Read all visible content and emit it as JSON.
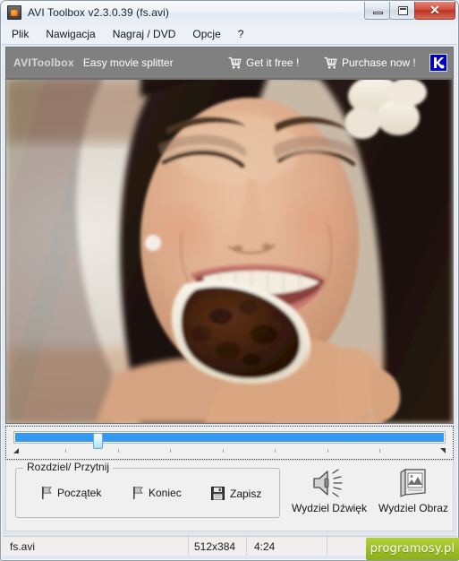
{
  "window": {
    "title": "AVI Toolbox v2.3.0.39 (fs.avi)",
    "icon": "app-film-icon",
    "controls": {
      "minimize": "minimize-button",
      "maximize": "maximize-button",
      "close_glyph": "✕"
    }
  },
  "menubar": {
    "items": [
      {
        "label": "Plik"
      },
      {
        "label": "Nawigacja"
      },
      {
        "label": "Nagraj / DVD"
      },
      {
        "label": "Opcje"
      },
      {
        "label": "?"
      }
    ]
  },
  "adbar": {
    "brand": "AVIToolbox",
    "tagline": "Easy movie splitter",
    "get_free_label": "Get it free !",
    "purchase_label": "Purchase now !",
    "badge_letter": "K",
    "background_color": "#808080",
    "badge_color": "#0000d2"
  },
  "player": {
    "scrub": {
      "position_percent": 17,
      "fill_color": "#3399f3",
      "tick_count": 9
    }
  },
  "tools": {
    "group_title": "Rozdziel/ Przytnij",
    "start_label": "Początek",
    "end_label": "Koniec",
    "save_label": "Zapisz",
    "extract_audio_label": "Wydziel Dźwięk",
    "extract_video_label": "Wydziel Obraz"
  },
  "statusbar": {
    "filename": "fs.avi",
    "dimensions": "512x384",
    "duration": "4:24",
    "watermark": "programosy.pl",
    "watermark_color": "#9cbe25"
  }
}
